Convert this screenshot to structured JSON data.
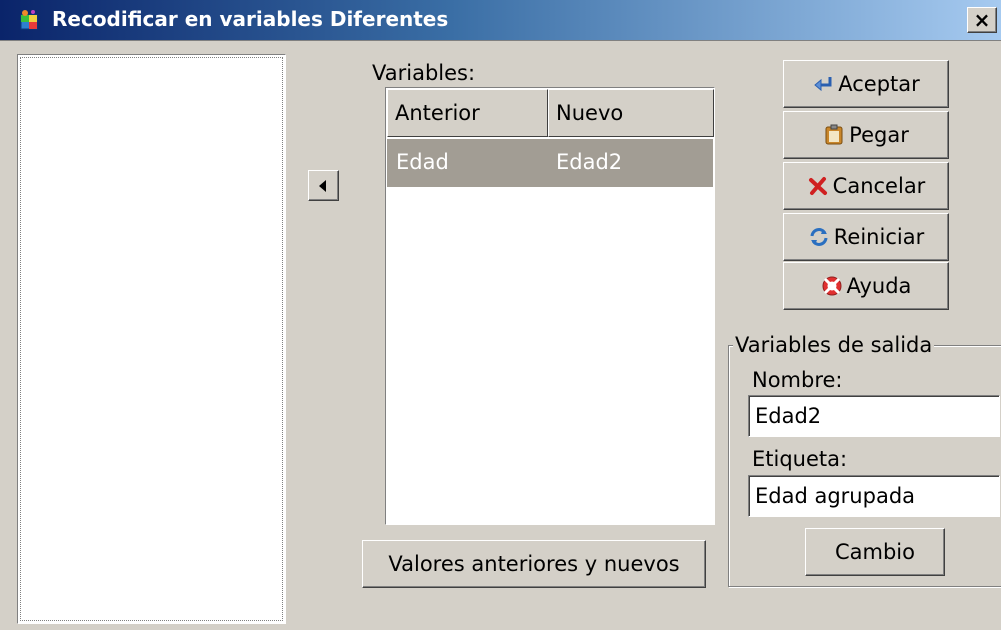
{
  "window": {
    "title": "Recodificar en variables Diferentes",
    "close_label": "×"
  },
  "variables": {
    "label": "Variables:",
    "columns": [
      "Anterior",
      "Nuevo"
    ],
    "rows": [
      {
        "anterior": "Edad",
        "nuevo": "Edad2",
        "selected": true
      }
    ]
  },
  "buttons": {
    "aceptar": "Aceptar",
    "pegar": "Pegar",
    "cancelar": "Cancelar",
    "reiniciar": "Reiniciar",
    "ayuda": "Ayuda",
    "valores": "Valores anteriores y nuevos",
    "cambio": "Cambio"
  },
  "output": {
    "group_label": "Variables de salida",
    "nombre_label": "Nombre:",
    "nombre_value": "Edad2",
    "etiqueta_label": "Etiqueta:",
    "etiqueta_value": "Edad agrupada"
  },
  "icons": {
    "app": "recode-app-icon",
    "aceptar": "enter-arrow-icon",
    "pegar": "clipboard-icon",
    "cancelar": "red-x-icon",
    "reiniciar": "refresh-icon",
    "ayuda": "lifebuoy-icon",
    "move": "left-arrow-icon"
  },
  "colors": {
    "titlebar_start": "#0a246a",
    "titlebar_end": "#a6caf0",
    "dialog_bg": "#d4d0c8",
    "selected_row": "#a29d94"
  }
}
